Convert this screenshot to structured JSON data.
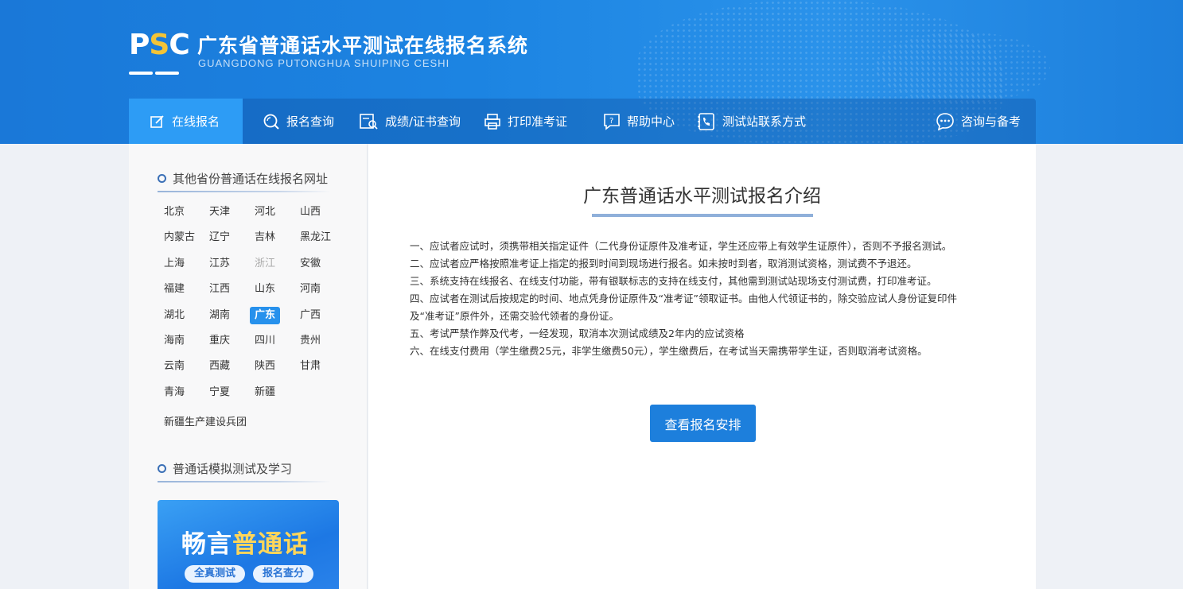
{
  "header": {
    "logo_text_p": "P",
    "logo_text_s": "S",
    "logo_text_c": "C",
    "title": "广东省普通话水平测试在线报名系统",
    "subtitle": "GUANGDONG PUTONGHUA SHUIPING CESHI"
  },
  "nav": {
    "items": [
      {
        "label": "在线报名",
        "icon": "edit-icon"
      },
      {
        "label": "报名查询",
        "icon": "search-icon"
      },
      {
        "label": "成绩/证书查询",
        "icon": "certificate-search-icon"
      },
      {
        "label": "打印准考证",
        "icon": "printer-icon"
      },
      {
        "label": "帮助中心",
        "icon": "help-icon"
      },
      {
        "label": "测试站联系方式",
        "icon": "phone-book-icon"
      },
      {
        "label": "咨询与备考",
        "icon": "chat-icon"
      }
    ],
    "active_index": 0
  },
  "sidebar": {
    "provinces_title": "其他省份普通话在线报名网址",
    "provinces": [
      "北京",
      "天津",
      "河北",
      "山西",
      "内蒙古",
      "辽宁",
      "吉林",
      "黑龙江",
      "上海",
      "江苏",
      "浙江",
      "安徽",
      "福建",
      "江西",
      "山东",
      "河南",
      "湖北",
      "湖南",
      "广东",
      "广西",
      "海南",
      "重庆",
      "四川",
      "贵州",
      "云南",
      "西藏",
      "陕西",
      "甘肃",
      "青海",
      "宁夏",
      "新疆"
    ],
    "special": "新疆生产建设兵团",
    "active_province": "广东",
    "disabled_province": "浙江",
    "study_title": "普通话模拟测试及学习",
    "promo": {
      "title_part1": "畅言",
      "title_part2": "普通话",
      "tag1": "全真测试",
      "tag2": "报名查分"
    }
  },
  "main": {
    "title": "广东普通话水平测试报名介绍",
    "rules": [
      "一、应试者应试时，须携带相关指定证件（二代身份证原件及准考证，学生还应带上有效学生证原件），否则不予报名测试。",
      "二、应试者应严格按照准考证上指定的报到时间到现场进行报名。如未按时到者，取消测试资格，测试费不予退还。",
      "三、系统支持在线报名、在线支付功能，带有银联标志的支持在线支付，其他需到测试站现场支付测试费，打印准考证。",
      "四、应试者在测试后按规定的时间、地点凭身份证原件及“准考证”领取证书。由他人代领证书的，除交验应试人身份证复印件",
      "及“准考证”原件外，还需交验代领者的身份证。",
      "五、考试严禁作弊及代考，一经发现，取消本次测试成绩及2年内的应试资格",
      "六、在线支付费用（学生缴费25元，非学生缴费50元），学生缴费后，在考试当天需携带学生证，否则取消考试资格。"
    ],
    "cta_label": "查看报名安排"
  }
}
